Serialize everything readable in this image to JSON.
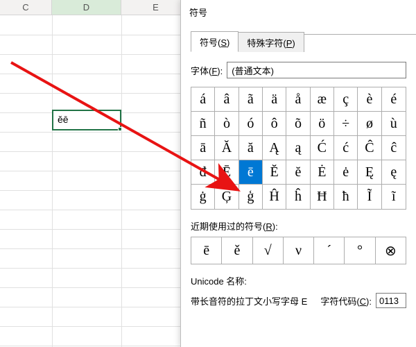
{
  "spreadsheet": {
    "columns": [
      "C",
      "D",
      "E"
    ],
    "active_column": "D",
    "selected_cell_value": "ěē"
  },
  "dialog": {
    "title": "符号",
    "tabs": {
      "symbols": "符号(S)",
      "special": "特殊字符(P)"
    },
    "font_label": "字体(F):",
    "font_value": "(普通文本)",
    "grid": [
      [
        "á",
        "â",
        "ã",
        "ä",
        "å",
        "æ",
        "ç",
        "è",
        "é"
      ],
      [
        "ñ",
        "ò",
        "ó",
        "ô",
        "õ",
        "ö",
        "÷",
        "ø",
        "ù"
      ],
      [
        "ā",
        "Ă",
        "ă",
        "Ą",
        "ą",
        "Ć",
        "ć",
        "Ĉ",
        "ĉ"
      ],
      [
        "đ",
        "Ē",
        "ē",
        "Ĕ",
        "ĕ",
        "Ė",
        "ė",
        "Ę",
        "ę"
      ],
      [
        "ġ",
        "Ģ",
        "ģ",
        "Ĥ",
        "ĥ",
        "Ħ",
        "ħ",
        "Ĩ",
        "ĩ"
      ]
    ],
    "selected_row": 3,
    "selected_col": 2,
    "recent_label": "近期使用过的符号(R):",
    "recent": [
      "ē",
      "ě",
      "√",
      "ν",
      "´",
      "°",
      "⊗"
    ],
    "unicode_name_label": "Unicode 名称:",
    "unicode_name": "带长音符的拉丁文小写字母 E",
    "char_code_label": "字符代码(C):",
    "char_code": "0113"
  }
}
